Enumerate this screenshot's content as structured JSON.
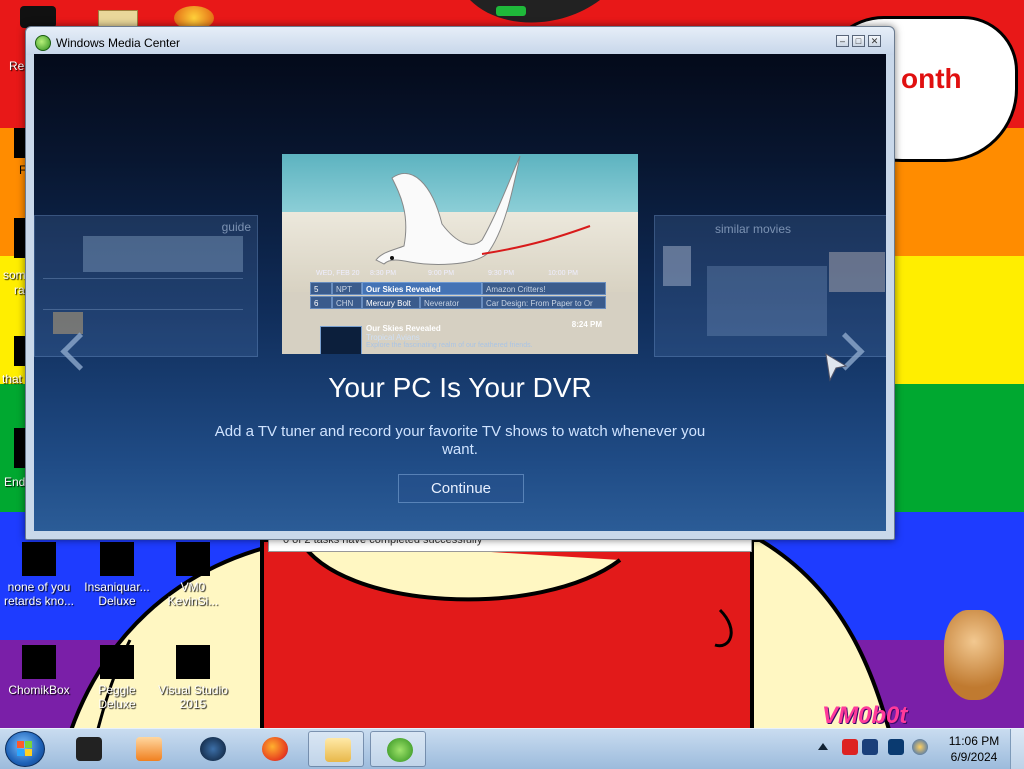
{
  "desktop": {
    "speech_text": "onth",
    "signature_text": "VM0b0t",
    "icons": [
      {
        "label": "none of you retards kno...",
        "name": "desktop-icon-none-of-you"
      },
      {
        "label": "Insaniquar... Deluxe",
        "name": "desktop-icon-insaniquarium"
      },
      {
        "label": "VM0 KevinSi...",
        "name": "desktop-icon-vm0"
      },
      {
        "label": "ChomikBox",
        "name": "desktop-icon-chomikbox"
      },
      {
        "label": "Peggle Deluxe",
        "name": "desktop-icon-peggle"
      },
      {
        "label": "Visual Studio 2015",
        "name": "desktop-icon-visual-studio"
      }
    ],
    "left_edge_labels": [
      "Rec",
      "F",
      "som",
      "ra",
      "that",
      "End"
    ],
    "background_dialog_text": "0 of 2 tasks have completed successfully"
  },
  "window": {
    "title": "Windows Media Center",
    "minimize_glyph": "–",
    "maximize_glyph": "□",
    "close_glyph": "✕"
  },
  "media_center": {
    "left_panel_label": "guide",
    "right_panel_label": "similar movies",
    "guide": {
      "times": [
        "WED, FEB 20",
        "8:30 PM",
        "9:00 PM",
        "9:30 PM",
        "10:00 PM"
      ],
      "rows": [
        {
          "num": "5",
          "channel": "NPT",
          "show": "Our Skies Revealed",
          "next": "Amazon Critters!"
        },
        {
          "num": "6",
          "channel": "CHN",
          "show": "Mercury Bolt",
          "show2": "Neverator",
          "next": "Car Design: From Paper to Or"
        }
      ],
      "info_title": "Our Skies Revealed",
      "info_subtitle": "Tropical Avians",
      "info_desc": "Explore the fascinating realm of our feathered friends.",
      "info_time": "8:24 PM"
    },
    "headline": "Your PC Is Your DVR",
    "description": "Add a TV tuner and record your favorite TV shows to watch whenever you want.",
    "continue_label": "Continue"
  },
  "taskbar": {
    "clock_time": "11:06 PM",
    "clock_date": "6/9/2024"
  },
  "colors": {
    "rainbow": [
      "#e81818",
      "#ff8c00",
      "#ffee00",
      "#00a830",
      "#1e3cff",
      "#7a1fa8"
    ],
    "wmc_accent": "#1f4b85"
  }
}
